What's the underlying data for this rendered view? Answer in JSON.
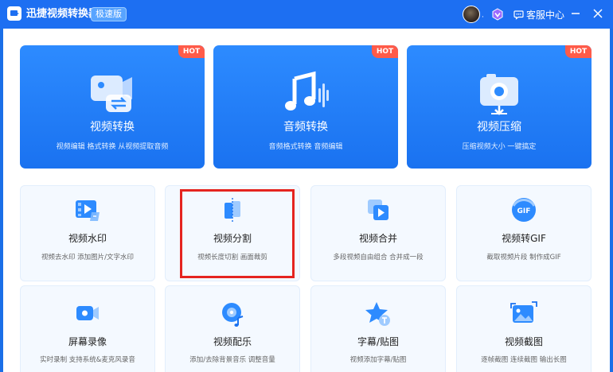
{
  "app": {
    "title": "迅捷视频转换器",
    "edition": "极速版",
    "customer_service": "客服中心",
    "avatar_dot": "·"
  },
  "colors": {
    "titlebar": "#1d6ff2",
    "card_blue": "#2d8bff",
    "hot_badge": "#ff5b49",
    "highlight": "#e5241f",
    "small_card_bg": "#f4f9ff"
  },
  "hot_label": "HOT",
  "big_cards": [
    {
      "icon": "video-convert-icon",
      "title": "视频转换",
      "desc": "视频编辑 格式转换 从视频提取音频"
    },
    {
      "icon": "audio-convert-icon",
      "title": "音频转换",
      "desc": "音频格式转换 音频编辑"
    },
    {
      "icon": "video-compress-icon",
      "title": "视频压缩",
      "desc": "压缩视频大小 一键搞定"
    }
  ],
  "small_cards": [
    {
      "icon": "watermark-icon",
      "title": "视频水印",
      "desc": "视频去水印 添加图片/文字水印"
    },
    {
      "icon": "split-icon",
      "title": "视频分割",
      "desc": "视频长度切割 画面裁剪"
    },
    {
      "icon": "merge-icon",
      "title": "视频合并",
      "desc": "多段视频自由组合 合并成一段"
    },
    {
      "icon": "gif-icon",
      "title": "视频转GIF",
      "desc": "截取视频片段 制作成GIF"
    },
    {
      "icon": "screen-record-icon",
      "title": "屏幕录像",
      "desc": "实时录制 支持系统&麦克风录音"
    },
    {
      "icon": "music-icon",
      "title": "视频配乐",
      "desc": "添加/去除背景音乐 调整音量"
    },
    {
      "icon": "subtitle-icon",
      "title": "字幕/贴图",
      "desc": "视频添加字幕/贴图"
    },
    {
      "icon": "screenshot-icon",
      "title": "视频截图",
      "desc": "逐帧截图 连续截图 输出长图"
    }
  ],
  "gif_icon_text": "GIF"
}
